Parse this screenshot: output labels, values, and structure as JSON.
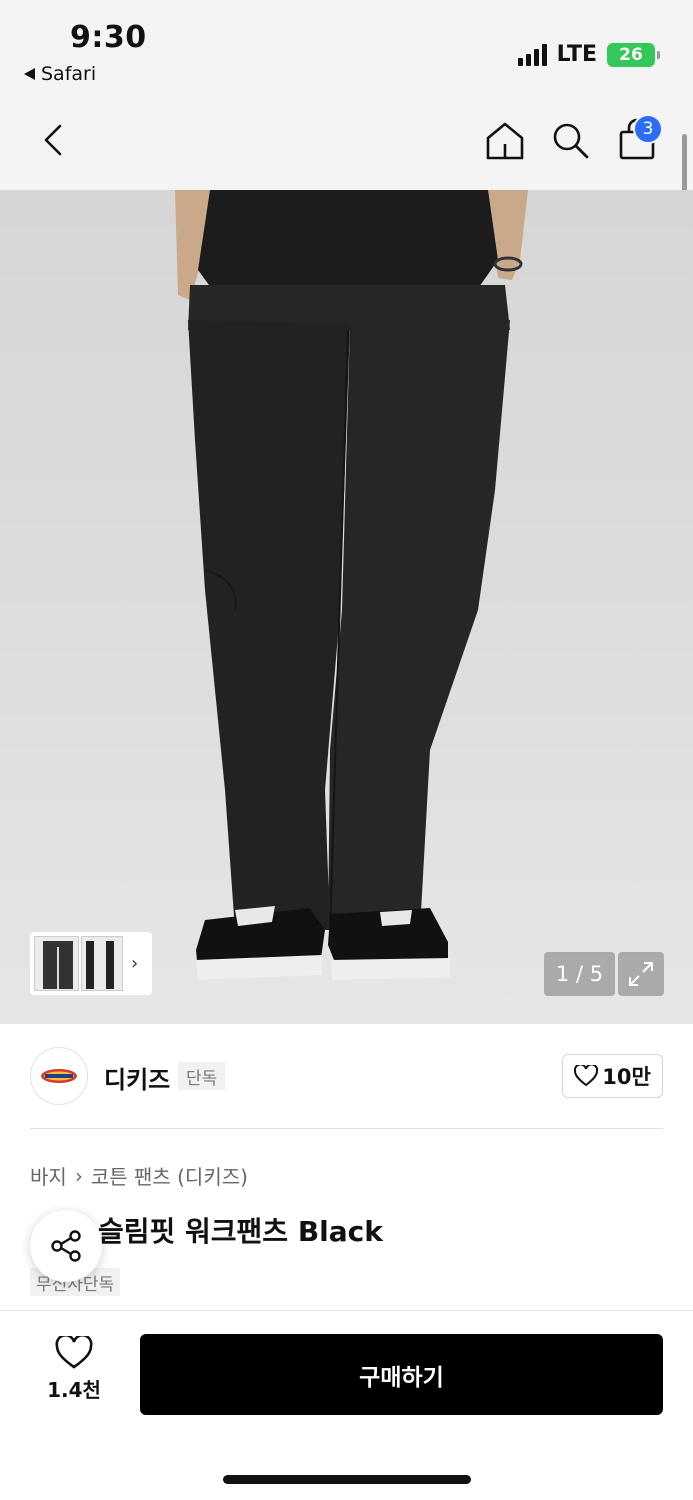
{
  "status_bar": {
    "time": "9:30",
    "back_app": "Safari",
    "network": "LTE",
    "battery": "26"
  },
  "nav": {
    "cart_count": "3"
  },
  "gallery": {
    "counter": "1 / 5"
  },
  "brand": {
    "name": "디키즈",
    "tag": "단독",
    "like_count": "10만"
  },
  "breadcrumb": {
    "category": "바지",
    "separator": "›",
    "subcategory": "코튼 팬츠 (디키즈)"
  },
  "product": {
    "title": "슬림핏 워크팬츠 Black",
    "tag": "무신사단독"
  },
  "bottom_bar": {
    "like_count": "1.4천",
    "buy_label": "구매하기"
  },
  "colors": {
    "accent": "#2b6ef6",
    "buy_button": "#000000",
    "battery": "#34c759"
  },
  "icons": {
    "back": "chevron-left-icon",
    "home": "home-icon",
    "search": "search-icon",
    "cart": "shopping-bag-icon",
    "expand": "expand-icon",
    "share": "share-icon",
    "heart": "heart-icon"
  }
}
